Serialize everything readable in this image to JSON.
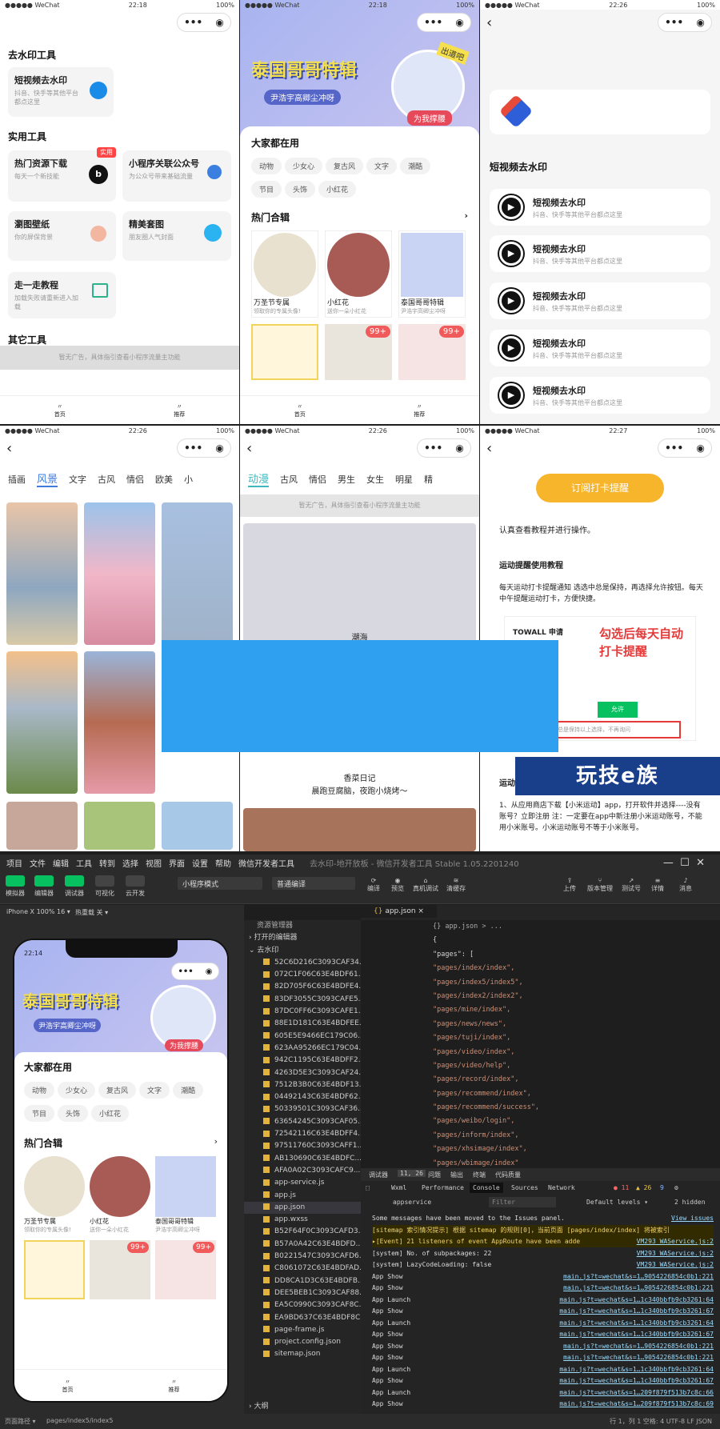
{
  "status": {
    "carrier": "●●●●● WeChat",
    "battery": "100%",
    "t1": "22:18",
    "t2": "22:18",
    "t3": "22:26",
    "t4": "22:26",
    "t5": "22:26",
    "t6": "22:27",
    "sim": "22:14"
  },
  "p1": {
    "section1": "去水印工具",
    "c1_title": "短视频去水印",
    "c1_sub": "抖音、快手等其他平台都点这里",
    "section2": "实用工具",
    "c2_title": "热门资源下载",
    "c2_sub": "每天一个新技能",
    "badge": "实用",
    "c3_title": "小程序关联公众号",
    "c3_sub": "为公众号带来基础流量",
    "c4_title": "瀏图壁纸",
    "c4_sub": "你的屏保背景",
    "c5_title": "精美套图",
    "c5_sub": "朋友圈人气封面",
    "c6_title": "走一走教程",
    "c6_sub": "加载失败请重新进入加载",
    "section3": "其它工具",
    "ad": "暂无广告，具体指引查看小程序流量主功能",
    "tab1": "首页",
    "tab2": "推荐"
  },
  "p2": {
    "banner_title": "泰国哥哥特辑",
    "banner_sub": "尹浩宇高卿尘冲呀",
    "banner_badge": "为我撑腰",
    "banner_tag": "出道吧",
    "everyone": "大家都在用",
    "chips": [
      "动物",
      "少女心",
      "复古风",
      "文字",
      "潮酷",
      "节目",
      "头饰",
      "小红花"
    ],
    "hot": "热门合辑",
    "g1": "万圣节专属",
    "g1s": "领取你的专属头像!",
    "g2": "小红花",
    "g2s": "送你一朵小红花",
    "g3": "泰国哥哥特辑",
    "g3s": "尹浩宇高卿尘冲呀",
    "badge99": "99+",
    "tab1": "首页",
    "tab2": "推荐"
  },
  "p3": {
    "section": "短视频去水印",
    "items": [
      {
        "t": "短视频去水印",
        "s": "抖音、快手等其他平台都点这里"
      },
      {
        "t": "短视频去水印",
        "s": "抖音、快手等其他平台都点这里"
      },
      {
        "t": "短视频去水印",
        "s": "抖音、快手等其他平台都点这里"
      },
      {
        "t": "短视频去水印",
        "s": "抖音、快手等其他平台都点这里"
      },
      {
        "t": "短视频去水印",
        "s": "抖音、快手等其他平台都点这里"
      }
    ]
  },
  "p4": {
    "tabs": [
      "插画",
      "风景",
      "文字",
      "古风",
      "情侣",
      "欧美",
      "小"
    ]
  },
  "p5": {
    "tabs": [
      "动漫",
      "古风",
      "情侣",
      "男生",
      "女生",
      "明星",
      "精"
    ],
    "ad": "暂无广告，具体指引查看小程序流量主功能",
    "cap1": "潮海",
    "cap2": "香菜日记",
    "cap3": "晨跑豆腐脑，夜跑小烧烤～"
  },
  "p6": {
    "button": "订阅打卡提醒",
    "note": "认真查看教程并进行操作。",
    "title": "运动提醒使用教程",
    "text": "每天运动打卡提醒通知 选选中总是保持，再选择允许按钮。每天中午提醒运动打卡，方便快捷。",
    "shot_app": "TOWALL 申请",
    "shot_red": "勾选后每天自动打卡提醒",
    "shot_btn": "允许",
    "shot_hint": "总是保持以上选择，不再询问",
    "sub": "运动",
    "step": "1、从应用商店下载【小米运动】app，打开软件并选择----没有账号？立即注册 注：一定要在app中新注册小米运动账号，不能用小米账号。小米运动账号不等于小米账号。"
  },
  "watermark": "玩技e族",
  "ide": {
    "menu": [
      "项目",
      "文件",
      "编辑",
      "工具",
      "转到",
      "选择",
      "视图",
      "界面",
      "设置",
      "帮助",
      "微信开发者工具"
    ],
    "title": "去水印-地开放板 - 微信开发者工具 Stable 1.05.2201240",
    "tools": [
      "模拟器",
      "编辑器",
      "调试器",
      "可视化",
      "云开发"
    ],
    "mode": "小程序模式",
    "compile": "普通编译",
    "tools2": [
      "编译",
      "预览",
      "真机调试",
      "清缓存"
    ],
    "tools3": [
      "上传",
      "版本管理",
      "测试号",
      "详情",
      "消息"
    ],
    "device": "iPhone X 100% 16 ▾",
    "hot": "热重载 关 ▾",
    "explorer": "资源管理器",
    "open_editors": "打开的编辑器",
    "folder": "去水印",
    "files": [
      "52C6D216C3093CAF34...",
      "072C1F06C63E4BDF61...",
      "82D705F6C63E4BDFE4...",
      "83DF3055C3093CAFE5...",
      "87DC0FF6C3093CAFE1...",
      "88E1D181C63E4BDFEE...",
      "605E5E9466EC179C06...",
      "623AA95266EC179C04...",
      "942C1195C63E4BDFF2...",
      "4263D5E3C3093CAF24...",
      "7512B3B0C63E4BDF13...",
      "04492143C63E4BDF62...",
      "50339501C3093CAF36...",
      "63654245C3093CAF05...",
      "72542116C63E4BDFF4...",
      "97511760C3093CAFF1...",
      "AB130690C63E4BDFC...",
      "AFA0A02C3093CAFC9...",
      "app-service.js",
      "app.js",
      "app.json",
      "app.wxss",
      "B52F64F0C3093CAFD3...",
      "B57A0A42C63E4BDFD...",
      "B0221547C3093CAFD6...",
      "C8061072C63E4BDFAD...",
      "DD8CA1D3C63E4BDFB...",
      "DEE5BEB1C3093CAF88...",
      "EA5C0990C3093CAF8C...",
      "EA9BD637C63E4BDF8C...",
      "page-frame.js",
      "project.config.json",
      "sitemap.json"
    ],
    "outline": "大纲",
    "tab": "app.json",
    "crumb": "{} app.json > ...",
    "code": [
      "{",
      "  \"pages\": [",
      "    \"pages/index/index\",",
      "    \"pages/index5/index5\",",
      "    \"pages/index2/index2\",",
      "    \"pages/mine/index\",",
      "    \"pages/news/news\",",
      "    \"pages/tuji/index\",",
      "    \"pages/video/index\",",
      "    \"pages/video/help\",",
      "    \"pages/record/index\",",
      "    \"pages/recommend/index\",",
      "    \"pages/recommend/success\",",
      "    \"pages/weibo/login\",",
      "    \"pages/inform/index\",",
      "    \"pages/xhsimage/index\",",
      "    \"pages/wbimage/index\""
    ],
    "dbg_tabs": [
      "调试器",
      "11, 26",
      "问题",
      "输出",
      "终端",
      "代码质量"
    ],
    "devtabs": [
      "Wxml",
      "Performance",
      "Console",
      "Sources",
      "Network"
    ],
    "errs": "● 11",
    "warns": "▲ 26",
    "infos": "9",
    "ctx": "appservice",
    "filter": "Filter",
    "levels": "Default levels ▾",
    "hidden": "2 hidden",
    "console": [
      {
        "t": "Some messages have been moved to the Issues panel.",
        "l": "View issues"
      },
      {
        "t": "[sitemap 索引情况提示] 根据 sitemap 的规则[0]，当前页面 [pages/index/index] 将被索引",
        "l": ""
      },
      {
        "t": "▸[Event] 21 listeners of event AppRoute have been added, possibly causing memory leak.",
        "l": "VM293 WAService.js:2"
      },
      {
        "t": "[system] No. of subpackages: 22",
        "l": "VM293 WAService.js:2"
      },
      {
        "t": "[system] LazyCodeLoading: false",
        "l": "VM293 WAService.js:2"
      },
      {
        "t": "App Show",
        "l": "main.js?t=wechat&s=1…9054226854c0b1:221"
      },
      {
        "t": "App Show",
        "l": "main.js?t=wechat&s=1…9054226854c0b1:221"
      },
      {
        "t": "App Launch",
        "l": "main.js?t=wechat&s=1…1c340bbfb9cb3261:64"
      },
      {
        "t": "App Show",
        "l": "main.js?t=wechat&s=1…1c340bbfb9cb3261:67"
      },
      {
        "t": "App Launch",
        "l": "main.js?t=wechat&s=1…1c340bbfb9cb3261:64"
      },
      {
        "t": "App Show",
        "l": "main.js?t=wechat&s=1…1c340bbfb9cb3261:67"
      },
      {
        "t": "App Show",
        "l": "main.js?t=wechat&s=1…9054226854c0b1:221"
      },
      {
        "t": "App Show",
        "l": "main.js?t=wechat&s=1…9054226854c0b1:221"
      },
      {
        "t": "App Launch",
        "l": "main.js?t=wechat&s=1…1c340bbfb9cb3261:64"
      },
      {
        "t": "App Show",
        "l": "main.js?t=wechat&s=1…1c340bbfb9cb3261:67"
      },
      {
        "t": "App Launch",
        "l": "main.js?t=wechat&s=1…209f879f513b7c8c:66"
      },
      {
        "t": "App Show",
        "l": "main.js?t=wechat&s=1…209f879f513b7c8c:69"
      }
    ],
    "path_label": "页面路径 ▾",
    "path": "pages/index5/index5",
    "status_right": "行 1，列 1   空格: 4   UTF-8   LF   JSON"
  }
}
